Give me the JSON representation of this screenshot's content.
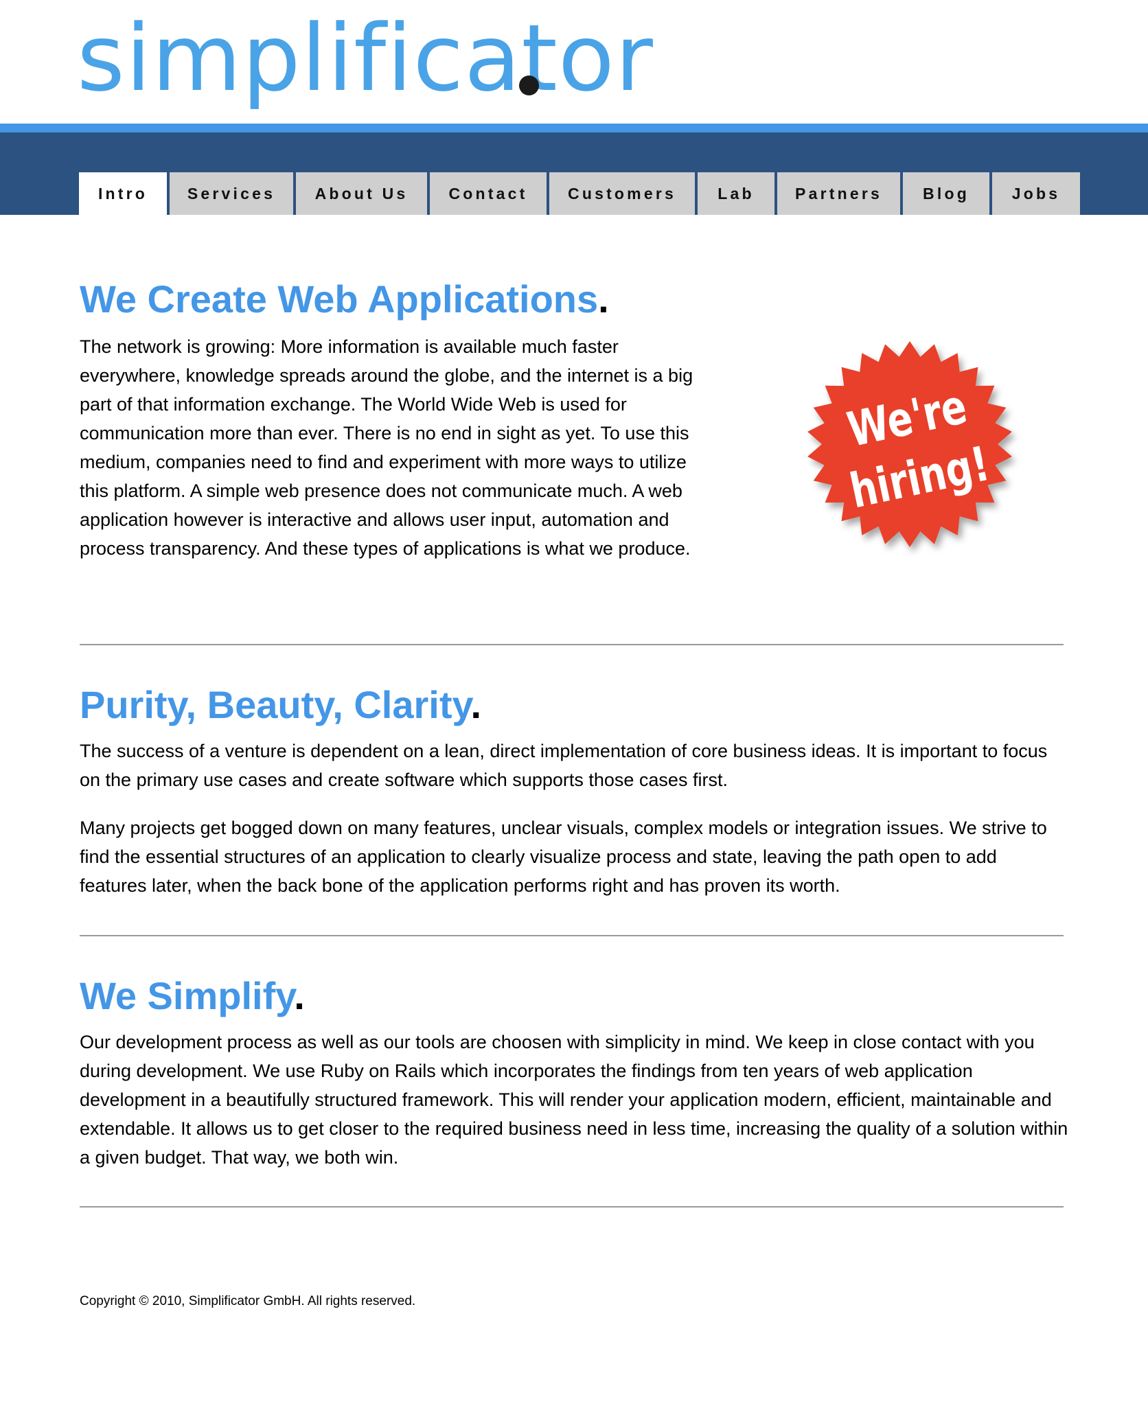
{
  "header": {
    "logo_text": "simplificator",
    "logo_dot": "."
  },
  "nav": {
    "tabs": [
      {
        "label": "Intro",
        "active": true
      },
      {
        "label": "Services",
        "active": false
      },
      {
        "label": "About Us",
        "active": false
      },
      {
        "label": "Contact",
        "active": false
      },
      {
        "label": "Customers",
        "active": false
      },
      {
        "label": "Lab",
        "active": false
      },
      {
        "label": "Partners",
        "active": false
      },
      {
        "label": "Blog",
        "active": false
      },
      {
        "label": "Jobs",
        "active": false
      }
    ]
  },
  "sections": [
    {
      "title": "We Create Web Applications",
      "period": ".",
      "paragraphs": [
        "The network is growing: More information is available much faster everywhere, knowledge spreads around the globe, and the internet is a big part of that information exchange. The World Wide Web is used for communication more than ever. There is no end in sight as yet. To use this medium, companies need to find and experiment with more ways to utilize this platform. A simple web presence does not communicate much. A web application however is interactive and allows user input, automation and process transparency. And these types of applications is what we produce."
      ]
    },
    {
      "title": "Purity, Beauty, Clarity",
      "period": ".",
      "paragraphs": [
        "The success of a venture is dependent on a lean, direct implementation of core business ideas. It is important to focus on the primary use cases and create software which supports those cases first.",
        "Many projects get bogged down on many features, unclear visuals, complex models or integration issues. We strive to find the essential structures of an application to clearly visualize process and state, leaving the path open to add features later, when the back bone of the application performs right and has proven its worth."
      ]
    },
    {
      "title": "We Simplify",
      "period": ".",
      "paragraphs": [
        "Our development process as well as our tools are choosen with simplicity in mind. We keep in close contact with you during development. We use Ruby on Rails which incorporates the findings from ten years of web application development in a beautifully structured framework. This will render your application modern, efficient, maintainable and extendable. It allows us to get closer to the required business need in less time, increasing the quality of a solution within a given budget. That way, we both win."
      ]
    }
  ],
  "badge": {
    "line1": "We're",
    "line2": "hiring!",
    "color": "#e8412a"
  },
  "footer": {
    "copyright": "Copyright © 2010, Simplificator GmbH. All rights reserved."
  },
  "colors": {
    "accent": "#4496e6",
    "nav_band": "#2b5281",
    "logo": "#4aa3e6"
  }
}
